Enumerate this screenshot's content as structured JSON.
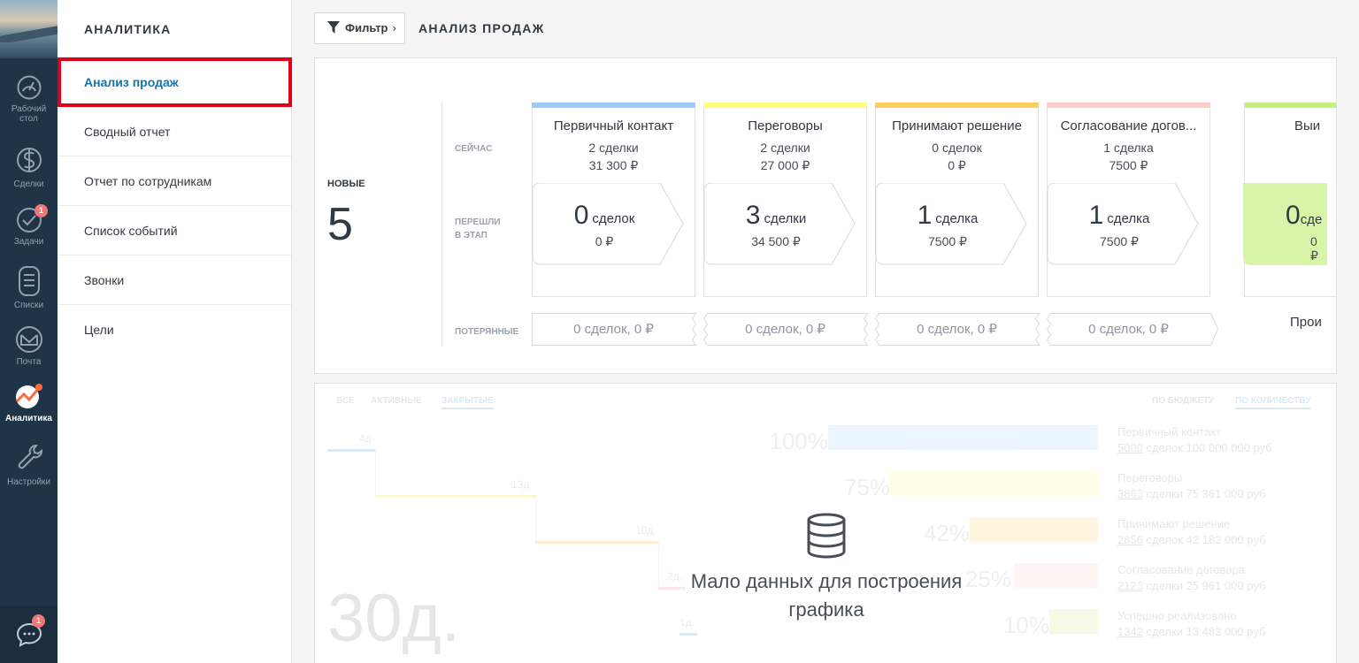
{
  "rail": {
    "items": [
      {
        "label1": "Рабочий",
        "label2": "стол",
        "icon": "speedometer-icon"
      },
      {
        "label1": "Сделки",
        "icon": "dollar-icon"
      },
      {
        "label1": "Задачи",
        "icon": "check-circle-icon",
        "badge": "1"
      },
      {
        "label1": "Списки",
        "icon": "list-icon"
      },
      {
        "label1": "Почта",
        "icon": "mail-icon"
      },
      {
        "label1": "Аналитика",
        "icon": "analytics-icon",
        "active": true
      },
      {
        "label1": "Настройки",
        "icon": "wrench-icon"
      }
    ],
    "chat_badge": "1"
  },
  "subnav": {
    "title": "АНАЛИТИКА",
    "items": [
      {
        "label": "Анализ продаж",
        "active": true
      },
      {
        "label": "Сводный отчет"
      },
      {
        "label": "Отчет по сотрудникам"
      },
      {
        "label": "Список событий"
      },
      {
        "label": "Звонки"
      },
      {
        "label": "Цели"
      }
    ]
  },
  "topbar": {
    "filter_label": "Фильтр",
    "filter_chevron": "›",
    "page_title": "АНАЛИЗ ПРОДАЖ"
  },
  "funnel": {
    "new_label": "НОВЫЕ",
    "new_count": "5",
    "row_now": "СЕЙЧАС",
    "row_moved_1": "ПЕРЕШЛИ",
    "row_moved_2": "В ЭТАП",
    "row_lost": "ПОТЕРЯННЫЕ",
    "stages": [
      {
        "name": "Первичный контакт",
        "count": "2 сделки",
        "sum": "31 300 ₽",
        "moved_n": "0",
        "moved_word": "сделок",
        "moved_sum": "0 ₽",
        "lost": "0 сделок, 0 ₽",
        "color": "#99ccfd"
      },
      {
        "name": "Переговоры",
        "count": "2 сделки",
        "sum": "27 000 ₽",
        "moved_n": "3",
        "moved_word": "сделки",
        "moved_sum": "34 500 ₽",
        "lost": "0 сделок, 0 ₽",
        "color": "#fffd7f"
      },
      {
        "name": "Принимают решение",
        "count": "0 сделок",
        "sum": "0 ₽",
        "moved_n": "1",
        "moved_word": "сделка",
        "moved_sum": "7500 ₽",
        "lost": "0 сделок, 0 ₽",
        "color": "#ffce5a"
      },
      {
        "name": "Согласование догов...",
        "count": "1 сделка",
        "sum": "7500 ₽",
        "moved_n": "1",
        "moved_word": "сделка",
        "moved_sum": "7500 ₽",
        "lost": "0 сделок, 0 ₽",
        "color": "#ffcccc"
      }
    ],
    "won": {
      "name": "Выи",
      "moved_n": "0",
      "moved_word": "сде",
      "moved_sum": "0 ₽",
      "footer": "Прои",
      "color": "#c8ef7e"
    }
  },
  "chart": {
    "tabs": [
      "ВСЕ",
      "АКТИВНЫЕ",
      "ЗАКРЫТЫЕ"
    ],
    "modes": [
      "ПО БЮДЖЕТУ",
      "ПО КОЛИЧЕСТВУ"
    ],
    "durations": [
      "4д.",
      "13д.",
      "10д.",
      "2д.",
      "1д."
    ],
    "total_days": "30д.",
    "percents": [
      "100%",
      "75%",
      "42%",
      "25%",
      "10%"
    ],
    "legend": [
      {
        "name": "Первичный контакт",
        "num": "5000",
        "rest": " сделок 100 000 000 руб"
      },
      {
        "name": "Переговоры",
        "num": "3863",
        "rest": " сделки 75 361 000 руб"
      },
      {
        "name": "Принимают решение",
        "num": "2856",
        "rest": " сделок 42 182 000 руб"
      },
      {
        "name": "Согласование договора",
        "num": "2123",
        "rest": " сделки 25 961 000 руб"
      },
      {
        "name": "Успешно реализовано",
        "num": "1342",
        "rest": " сделки 13 483 000 руб"
      }
    ],
    "empty_message": "Мало данных для построения графика"
  }
}
